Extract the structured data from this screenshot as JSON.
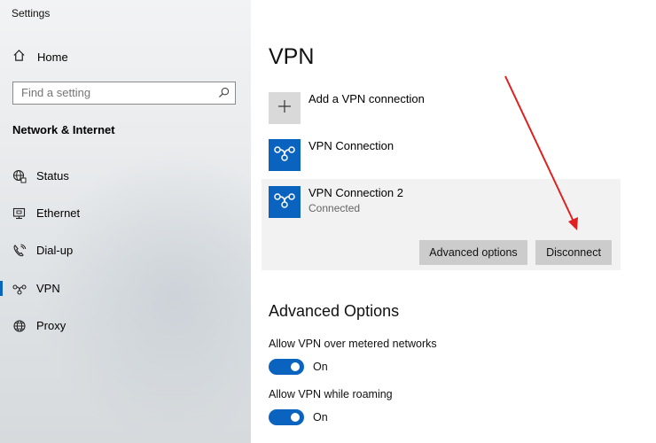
{
  "window": {
    "title": "Settings"
  },
  "sidebar": {
    "home_label": "Home",
    "search": {
      "placeholder": "Find a setting"
    },
    "section_title": "Network & Internet",
    "items": [
      {
        "label": "Status",
        "icon": "globe-status-icon"
      },
      {
        "label": "Ethernet",
        "icon": "ethernet-monitor-icon"
      },
      {
        "label": "Dial-up",
        "icon": "dialup-phone-icon"
      },
      {
        "label": "VPN",
        "icon": "vpn-icon",
        "active": true
      },
      {
        "label": "Proxy",
        "icon": "globe-icon"
      }
    ]
  },
  "main": {
    "title": "VPN",
    "add_connection_label": "Add a VPN connection",
    "connections": [
      {
        "name": "VPN Connection",
        "status": ""
      },
      {
        "name": "VPN Connection 2",
        "status": "Connected"
      }
    ],
    "buttons": {
      "advanced": "Advanced options",
      "disconnect": "Disconnect"
    },
    "advanced_heading": "Advanced Options",
    "options": [
      {
        "label": "Allow VPN over metered networks",
        "state": "On",
        "enabled": true
      },
      {
        "label": "Allow VPN while roaming",
        "state": "On",
        "enabled": true
      }
    ]
  },
  "colors": {
    "accent": "#0a64bf",
    "annotation_arrow": "#e02020"
  }
}
